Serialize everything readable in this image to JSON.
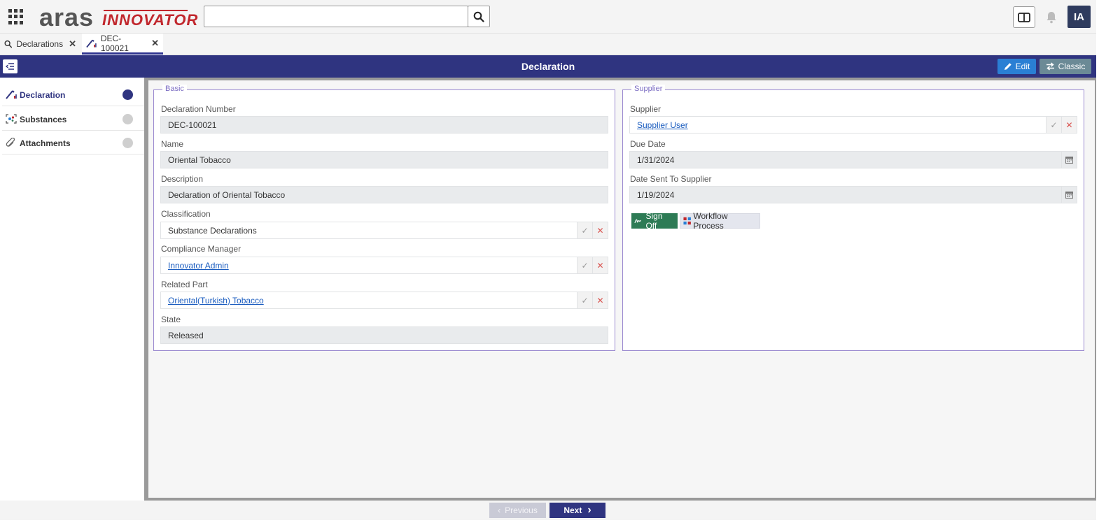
{
  "header": {
    "logo_main": "aras",
    "logo_sub": "INNOVATOR",
    "search_placeholder": "",
    "avatar_initials": "IA"
  },
  "tabs": [
    {
      "label": "Declarations",
      "icon": "search-icon"
    },
    {
      "label": "DEC-100021",
      "icon": "declaration-icon",
      "active": true
    }
  ],
  "titlebar": {
    "title": "Declaration",
    "edit_label": "Edit",
    "classic_label": "Classic"
  },
  "sidebar": {
    "items": [
      {
        "label": "Declaration",
        "icon": "declaration-icon",
        "active": true
      },
      {
        "label": "Substances",
        "icon": "substances-icon"
      },
      {
        "label": "Attachments",
        "icon": "paperclip-icon"
      }
    ]
  },
  "basic": {
    "legend": "Basic",
    "declaration_number_label": "Declaration Number",
    "declaration_number": "DEC-100021",
    "name_label": "Name",
    "name": "Oriental Tobacco",
    "description_label": "Description",
    "description": "Declaration of Oriental Tobacco",
    "classification_label": "Classification",
    "classification": "Substance Declarations",
    "compliance_manager_label": "Compliance Manager",
    "compliance_manager": "Innovator Admin",
    "related_part_label": "Related Part",
    "related_part": "Oriental(Turkish) Tobacco",
    "state_label": "State",
    "state": "Released"
  },
  "supplier": {
    "legend": "Supplier",
    "supplier_label": "Supplier",
    "supplier": "Supplier User",
    "due_date_label": "Due Date",
    "due_date": "1/31/2024",
    "date_sent_label": "Date Sent To Supplier",
    "date_sent": "1/19/2024",
    "signoff_label": "Sign Off",
    "workflow_label": "Workflow Process"
  },
  "footer": {
    "previous_label": "Previous",
    "next_label": "Next"
  },
  "colors": {
    "primary": "#2f3480",
    "edit": "#2a7fd4",
    "classic": "#6b8a96",
    "signoff": "#2d7b55",
    "group_border": "#9b8ad0",
    "logo_red": "#c1272d"
  }
}
